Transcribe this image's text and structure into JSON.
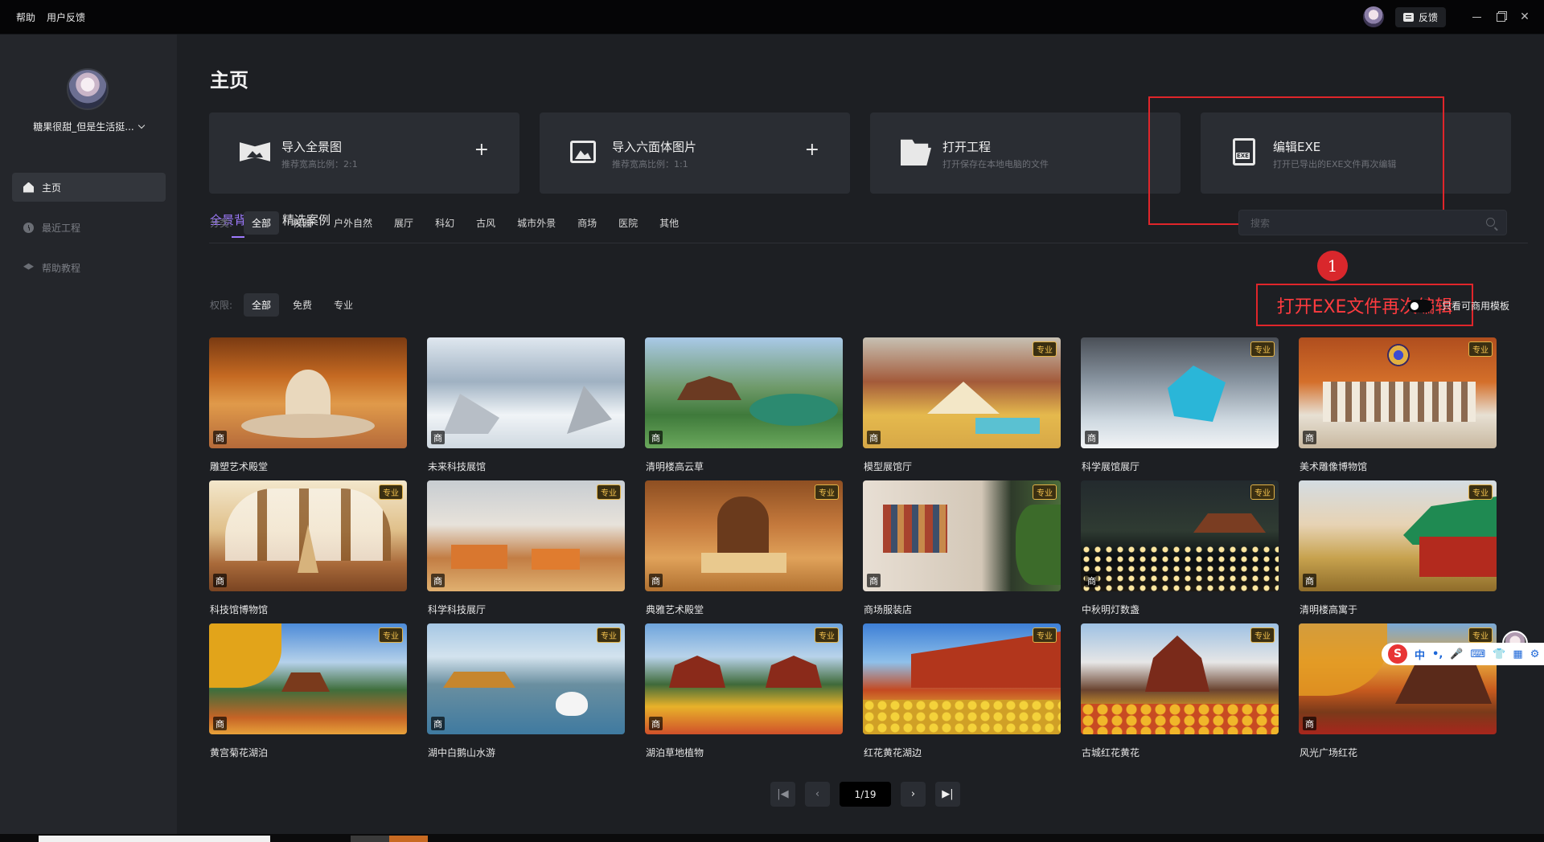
{
  "titlebar": {
    "menu": [
      "帮助",
      "用户反馈"
    ],
    "feedback_label": "反馈"
  },
  "sidebar": {
    "username": "糖果很甜_但是生活挺...",
    "nav": [
      {
        "label": "主页",
        "icon": "home-icon",
        "active": true
      },
      {
        "label": "最近工程",
        "icon": "clock-icon",
        "active": false
      },
      {
        "label": "帮助教程",
        "icon": "graduation-cap-icon",
        "active": false
      }
    ]
  },
  "main": {
    "title": "主页",
    "cards": [
      {
        "title": "导入全景图",
        "subtitle": "推荐宽高比例：2:1",
        "icon": "panorama-icon",
        "plus": "+"
      },
      {
        "title": "导入六面体图片",
        "subtitle": "推荐宽高比例：1:1",
        "icon": "image-icon",
        "plus": "+"
      },
      {
        "title": "打开工程",
        "subtitle": "打开保存在本地电脑的文件",
        "icon": "folder-icon"
      },
      {
        "title": "编辑EXE",
        "subtitle": "打开已导出的EXE文件再次编辑",
        "icon": "exe-file-icon"
      }
    ],
    "tabs": [
      {
        "label": "全景背景",
        "active": true
      },
      {
        "label": "精选案例",
        "active": false
      }
    ],
    "search_placeholder": "搜索",
    "annotation": {
      "number": "1",
      "text": "打开EXE文件再次编辑",
      "color": "#e0252a"
    },
    "category_filter": {
      "label": "分类:",
      "options": [
        "全部",
        "校园",
        "户外自然",
        "展厅",
        "科幻",
        "古风",
        "城市外景",
        "商场",
        "医院",
        "其他"
      ],
      "selected": "全部"
    },
    "permission_filter": {
      "label": "权限:",
      "options": [
        "全部",
        "免费",
        "专业"
      ],
      "selected": "全部"
    },
    "commercial_toggle": {
      "label": "只看可商用模板",
      "on": false
    },
    "badges": {
      "commercial": "商",
      "pro": "专业"
    },
    "templates": [
      {
        "name": "雕塑艺术殿堂",
        "pro": false
      },
      {
        "name": "未来科技展馆",
        "pro": false
      },
      {
        "name": "清明楼高云草",
        "pro": false
      },
      {
        "name": "模型展馆厅",
        "pro": true
      },
      {
        "name": "科学展馆展厅",
        "pro": true
      },
      {
        "name": "美术雕像博物馆",
        "pro": true
      },
      {
        "name": "科技馆博物馆",
        "pro": true
      },
      {
        "name": "科学科技展厅",
        "pro": true
      },
      {
        "name": "典雅艺术殿堂",
        "pro": true
      },
      {
        "name": "商场服装店",
        "pro": true
      },
      {
        "name": "中秋明灯数盏",
        "pro": true
      },
      {
        "name": "清明楼高寓于",
        "pro": true
      },
      {
        "name": "黄宫菊花湖泊",
        "pro": true
      },
      {
        "name": "湖中白鹅山水游",
        "pro": true
      },
      {
        "name": "湖泊草地植物",
        "pro": true
      },
      {
        "name": "红花黄花湖边",
        "pro": true
      },
      {
        "name": "古城红花黄花",
        "pro": true
      },
      {
        "name": "风光广场红花",
        "pro": true
      }
    ],
    "pagination": {
      "current": "1/19"
    }
  },
  "colors": {
    "accent": "#9f7bff",
    "annotation_red": "#e0252a",
    "pro_badge": "#f2c14e"
  }
}
